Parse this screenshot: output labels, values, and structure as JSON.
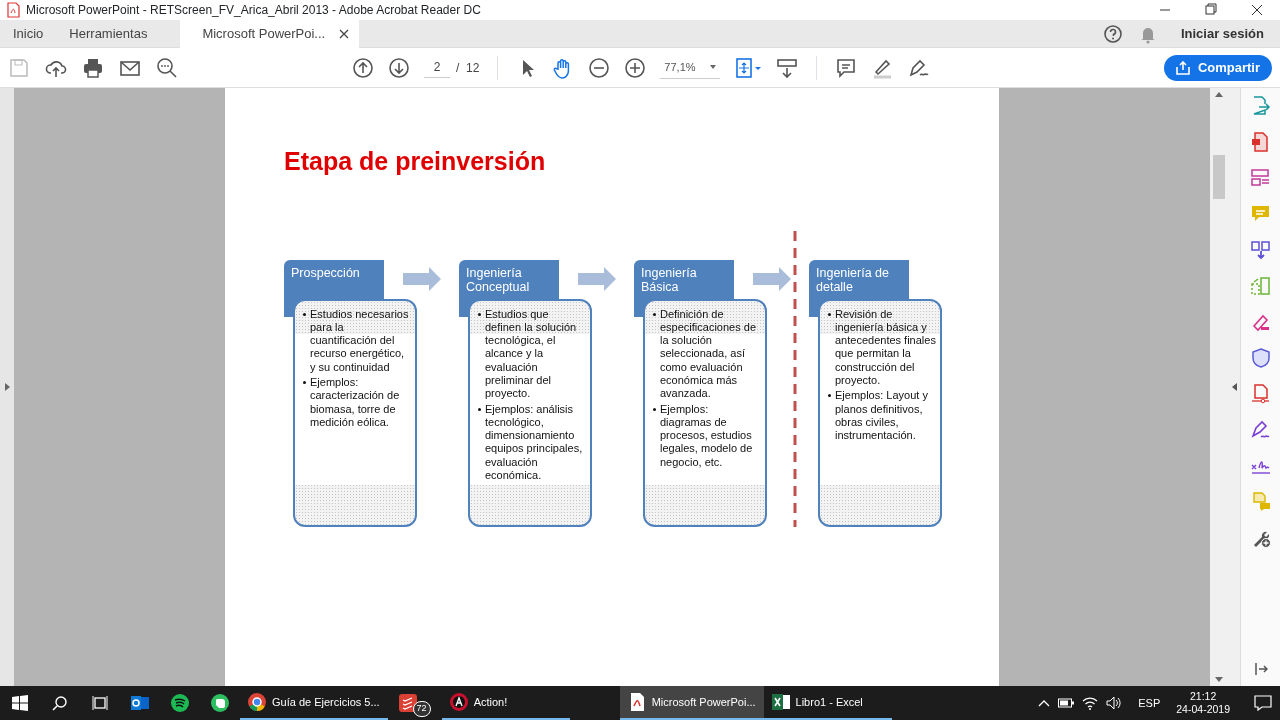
{
  "window": {
    "title": "Microsoft PowerPoint - RETScreen_FV_Arica_Abril 2013 - Adobe Acrobat Reader DC"
  },
  "tabs": [
    {
      "label": "Inicio",
      "selected": false
    },
    {
      "label": "Herramientas",
      "selected": false
    },
    {
      "label": "Microsoft PowerPoi...",
      "selected": true
    }
  ],
  "account": {
    "sign_in": "Iniciar sesión"
  },
  "toolbar": {
    "page_current": "2",
    "page_separator": "/",
    "page_total": "12",
    "zoom": "77,1%",
    "share": "Compartir"
  },
  "document": {
    "title": "Etapa de preinversión",
    "stages": [
      {
        "heading": "Prospección",
        "boundary_before": false,
        "bullets": [
          "Estudios necesarios para la cuantificación del recurso energético, y su continuidad",
          "Ejemplos: caracterización de biomasa, torre de medición eólica."
        ]
      },
      {
        "heading": "Ingeniería Conceptual",
        "boundary_before": false,
        "bullets": [
          "Estudios que definen la solución tecnológica, el alcance y la evaluación preliminar del proyecto.",
          "Ejemplos: análisis tecnológico, dimensionamiento equipos principales, evaluación económica."
        ]
      },
      {
        "heading": "Ingeniería Básica",
        "boundary_before": false,
        "bullets": [
          "Definición de especificaciones de la solución seleccionada, así como evaluación económica más avanzada.",
          "Ejemplos: diagramas de procesos, estudios legales, modelo de negocio, etc."
        ]
      },
      {
        "heading": "Ingeniería de detalle",
        "boundary_before": true,
        "bullets": [
          "Revisión de ingeniería básica y antecedentes finales que permitan la construcción del proyecto.",
          "Ejemplos: Layout y planos definitivos, obras civiles, instrumentación."
        ]
      }
    ]
  },
  "taskbar": {
    "apps": [
      {
        "kind": "outlook",
        "selected": false
      },
      {
        "kind": "spotify",
        "selected": false
      },
      {
        "kind": "evernote",
        "selected": false
      },
      {
        "kind": "chrome",
        "label": "Guía de Ejercicios 5...",
        "selected": false
      },
      {
        "kind": "todoist",
        "badge": "72",
        "selected": false
      },
      {
        "kind": "action",
        "label": "Action!",
        "selected": false
      },
      {
        "kind": "acrobat",
        "label": "Microsoft PowerPoi...",
        "selected": true
      },
      {
        "kind": "excel",
        "label": "Libro1 - Excel",
        "selected": false
      }
    ]
  },
  "tray": {
    "language": "ESP",
    "time": "21:12",
    "date": "24-04-2019"
  }
}
